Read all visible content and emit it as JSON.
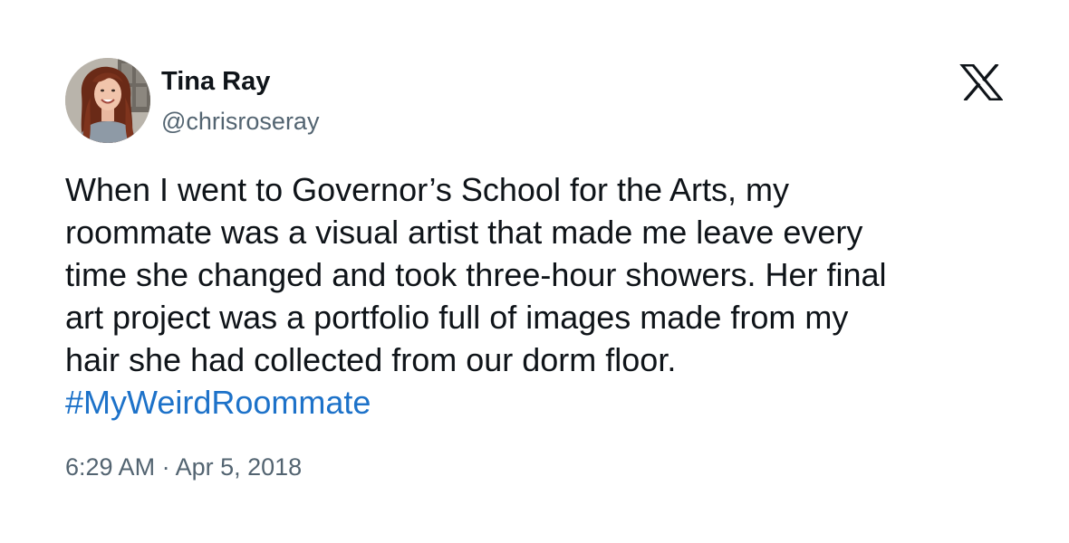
{
  "author": {
    "display_name": "Tina Ray",
    "handle": "@chrisroseray",
    "avatar_icon": "profile-photo"
  },
  "brand": {
    "logo_icon": "x-logo-icon",
    "logo_color": "#0f1419"
  },
  "tweet": {
    "text": "When I went to Governor’s School for the Arts, my\nroommate was a visual artist that made me leave every\ntime she changed and took three-hour showers. Her final\nart project was a portfolio full of images made from my\nhair she had collected from our dorm floor.",
    "hashtag": "#MyWeirdRoommate",
    "hashtag_color": "#1d72c9"
  },
  "meta": {
    "time": "6:29 AM",
    "separator": " · ",
    "date": "Apr 5, 2018"
  }
}
